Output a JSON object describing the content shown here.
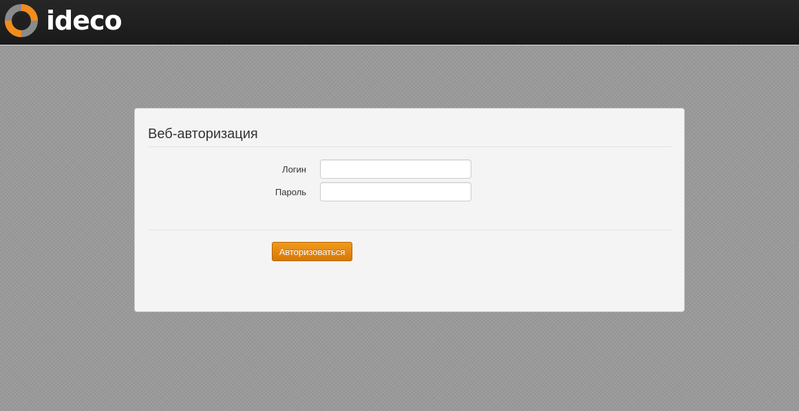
{
  "header": {
    "brand": "ideco",
    "logo_icon": "ideco-ring-logo-icon",
    "colors": {
      "logo_orange": "#f28c1b",
      "logo_gray": "#8a8a8a"
    }
  },
  "auth_form": {
    "title": "Веб-авторизация",
    "login_label": "Логин",
    "login_value": "",
    "password_label": "Пароль",
    "password_value": "",
    "submit_label": "Авторизоваться"
  },
  "colors": {
    "accent": "#e8850c",
    "panel_bg": "#f4f4f4",
    "header_bg": "#1f1f1f"
  }
}
